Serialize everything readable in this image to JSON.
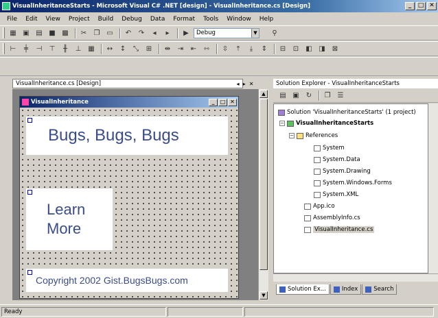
{
  "window": {
    "title": "VisualInheritanceStarts - Microsoft Visual C# .NET [design] - VisualInheritance.cs [Design]",
    "controls": [
      "_",
      "□",
      "✕"
    ]
  },
  "menu": [
    "File",
    "Edit",
    "View",
    "Project",
    "Build",
    "Debug",
    "Data",
    "Format",
    "Tools",
    "Window",
    "Help"
  ],
  "toolbar1": {
    "config_combo": "Debug"
  },
  "doc_tab": {
    "label": "VisualInheritance.cs [Design]",
    "pane_buttons": [
      "◂",
      "▸",
      "✕"
    ]
  },
  "form": {
    "title": "VisualInheritance",
    "title_buttons": [
      "_",
      "□",
      "✕"
    ],
    "banner_text": "Bugs, Bugs, Bugs",
    "learn_line1": "Learn",
    "learn_line2": "More",
    "footer_text": "Copyright 2002 Gist.BugsBugs.com"
  },
  "solution_explorer": {
    "title": "Solution Explorer - VisualInheritanceStarts",
    "tree": [
      {
        "label": "Solution 'VisualInheritanceStarts' (1 project)",
        "kind": "sol",
        "indent": 0
      },
      {
        "label": "VisualInheritanceStarts",
        "kind": "proj",
        "indent": 1,
        "expander": "−"
      },
      {
        "label": "References",
        "kind": "folder",
        "indent": 2,
        "expander": "−"
      },
      {
        "label": "System",
        "kind": "file",
        "indent": 3
      },
      {
        "label": "System.Data",
        "kind": "file",
        "indent": 3
      },
      {
        "label": "System.Drawing",
        "kind": "file",
        "indent": 3
      },
      {
        "label": "System.Windows.Forms",
        "kind": "file",
        "indent": 3
      },
      {
        "label": "System.XML",
        "kind": "file",
        "indent": 3
      },
      {
        "label": "App.ico",
        "kind": "file",
        "indent": 2
      },
      {
        "label": "AssemblyInfo.cs",
        "kind": "file",
        "indent": 2
      },
      {
        "label": "VisualInheritance.cs",
        "kind": "file",
        "indent": 2,
        "selected": true
      }
    ],
    "tabs": [
      {
        "label": "Solution Ex...",
        "active": true
      },
      {
        "label": "Index",
        "active": false
      },
      {
        "label": "Search",
        "active": false
      }
    ]
  },
  "status": {
    "text": "Ready"
  }
}
